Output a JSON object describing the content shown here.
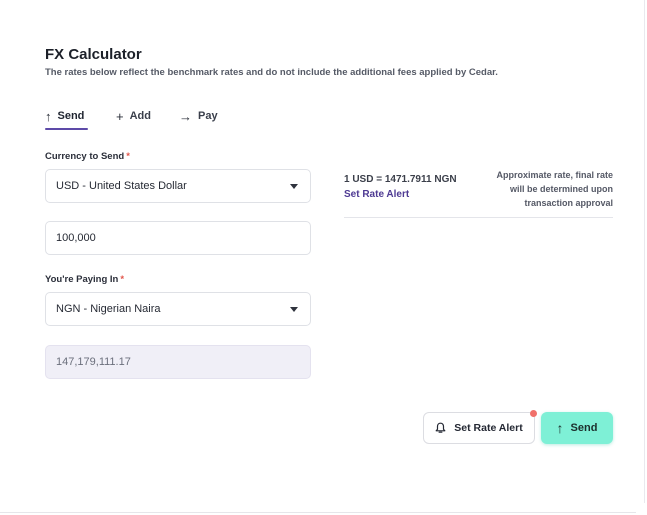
{
  "header": {
    "title": "FX Calculator",
    "subtitle": "The rates below reflect the benchmark rates and do not include the additional fees applied by Cedar."
  },
  "tabs": [
    {
      "label": "Send",
      "icon": "arrow-up-icon",
      "glyph": "↑",
      "active": true
    },
    {
      "label": "Add",
      "icon": "plus-icon",
      "glyph": "+",
      "active": false
    },
    {
      "label": "Pay",
      "icon": "arrow-right-icon",
      "glyph": "→",
      "active": false
    }
  ],
  "form": {
    "currency_to_send": {
      "label": "Currency to Send",
      "required_mark": "*",
      "value": "USD - United States Dollar"
    },
    "amount": {
      "value": "100,000"
    },
    "paying_in": {
      "label": "You're Paying In",
      "required_mark": "*",
      "value": "NGN - Nigerian Naira"
    },
    "converted_amount": {
      "value": "147,179,111.17"
    }
  },
  "rate": {
    "value": "1 USD = 1471.7911 NGN",
    "alert_link": "Set Rate Alert",
    "note": "Approximate rate, final rate will be determined upon transaction approval"
  },
  "actions": {
    "set_rate_alert": {
      "label": "Set Rate Alert",
      "icon": "bell-icon"
    },
    "send": {
      "label": "Send",
      "icon": "arrow-up-icon",
      "glyph": "↑"
    }
  },
  "colors": {
    "accent": "#5d4aa8",
    "send_button": "#7ef0d6",
    "required": "#e2574c",
    "notification_dot": "#f0706a"
  }
}
